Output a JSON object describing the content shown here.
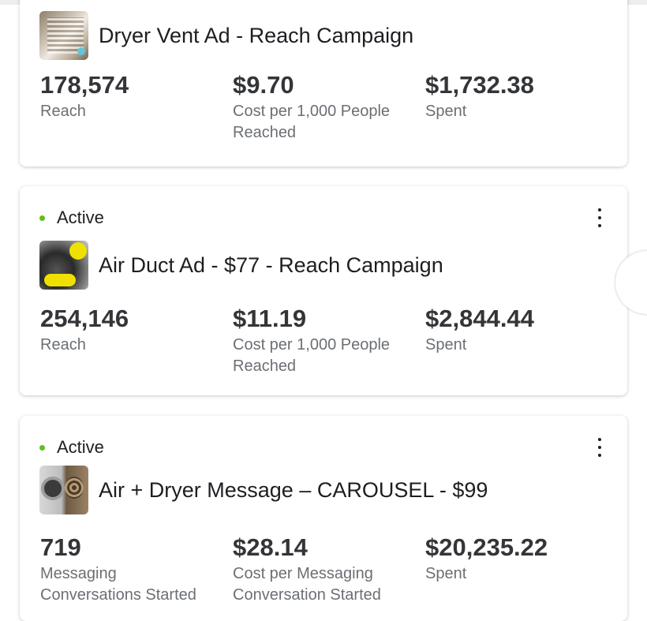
{
  "campaigns": [
    {
      "status": "",
      "thumbnail_icon": "dryer-vent-photo",
      "title": "Dryer Vent Ad - Reach Campaign",
      "metrics": [
        {
          "value": "178,574",
          "label": "Reach"
        },
        {
          "value": "$9.70",
          "label": "Cost per 1,000 People Reached"
        },
        {
          "value": "$1,732.38",
          "label": "Spent"
        }
      ]
    },
    {
      "status": "Active",
      "thumbnail_icon": "air-duct-photo",
      "title": "Air Duct Ad - $77 - Reach Campaign",
      "metrics": [
        {
          "value": "254,146",
          "label": "Reach"
        },
        {
          "value": "$11.19",
          "label": "Cost per 1,000 People Reached"
        },
        {
          "value": "$2,844.44",
          "label": "Spent"
        }
      ]
    },
    {
      "status": "Active",
      "thumbnail_icon": "carousel-photo",
      "title": "Air + Dryer Message – CAROUSEL - $99",
      "metrics": [
        {
          "value": "719",
          "label": "Messaging Conversations Started"
        },
        {
          "value": "$28.14",
          "label": "Cost per Messaging Conversation Started"
        },
        {
          "value": "$20,235.22",
          "label": "Spent"
        }
      ]
    }
  ],
  "colors": {
    "status_active": "#5cc01a",
    "metric_value": "#333538",
    "metric_label": "#6b6f74"
  }
}
